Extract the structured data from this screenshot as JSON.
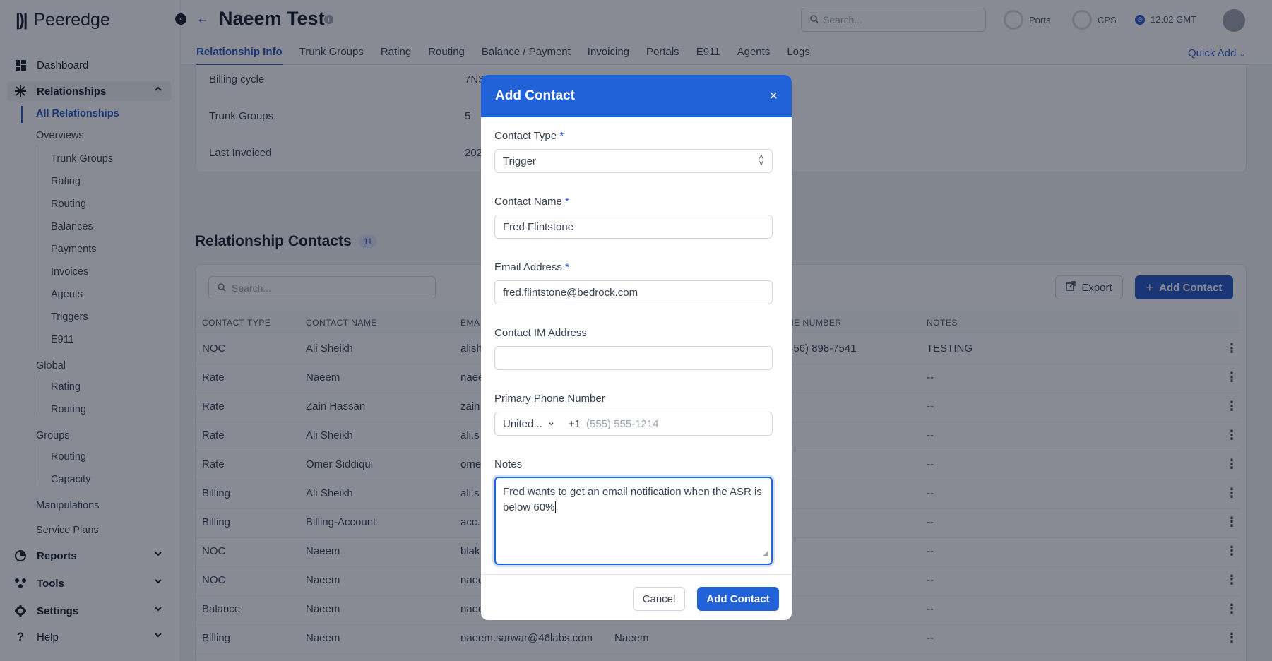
{
  "app": {
    "logo_text": "Peeredge"
  },
  "sidebar": {
    "dashboard": "Dashboard",
    "relationships": "Relationships",
    "all_relationships": "All Relationships",
    "overviews": "Overviews",
    "overview_items": [
      "Trunk Groups",
      "Rating",
      "Routing",
      "Balances",
      "Payments",
      "Invoices",
      "Agents",
      "Triggers",
      "E911"
    ],
    "global": "Global",
    "global_items": [
      "Rating",
      "Routing"
    ],
    "groups": "Groups",
    "groups_items": [
      "Routing",
      "Capacity"
    ],
    "manipulations": "Manipulations",
    "service_plans": "Service Plans",
    "reports": "Reports",
    "tools": "Tools",
    "settings": "Settings",
    "help": "Help"
  },
  "header": {
    "title": "Naeem Test",
    "search_placeholder": "Search...",
    "ports_label": "Ports",
    "cps_label": "CPS",
    "time": "12:02 GMT",
    "quick_add": "Quick Add",
    "tabs": [
      "Relationship Info",
      "Trunk Groups",
      "Rating",
      "Routing",
      "Balance / Payment",
      "Invoicing",
      "Portals",
      "E911",
      "Agents",
      "Logs"
    ]
  },
  "info": {
    "billing_cycle_label": "Billing cycle",
    "billing_cycle_value": "7N3",
    "trunk_groups_label": "Trunk Groups",
    "trunk_groups_value": "5",
    "last_invoiced_label": "Last Invoiced",
    "last_invoiced_value": "202"
  },
  "contacts": {
    "title": "Relationship Contacts",
    "count": "11",
    "search_placeholder": "Search...",
    "export_label": "Export",
    "add_label": "Add Contact",
    "headers": {
      "type": "CONTACT TYPE",
      "name": "CONTACT NAME",
      "email": "EMA",
      "phone": "NE NUMBER",
      "notes": "NOTES"
    },
    "rows": [
      {
        "type": "NOC",
        "name": "Ali Sheikh",
        "email": "alish",
        "extra": "",
        "phone": "456) 898-7541",
        "notes": "TESTING"
      },
      {
        "type": "Rate",
        "name": "Naeem",
        "email": "naee",
        "extra": "",
        "phone": "",
        "notes": "--"
      },
      {
        "type": "Rate",
        "name": "Zain Hassan",
        "email": "zain",
        "extra": "",
        "phone": "",
        "notes": "--"
      },
      {
        "type": "Rate",
        "name": "Ali Sheikh",
        "email": "ali.s",
        "extra": "",
        "phone": "",
        "notes": "--"
      },
      {
        "type": "Rate",
        "name": "Omer Siddiqui",
        "email": "ome",
        "extra": "",
        "phone": "",
        "notes": "--"
      },
      {
        "type": "Billing",
        "name": "Ali Sheikh",
        "email": "ali.s",
        "extra": "",
        "phone": "",
        "notes": "--"
      },
      {
        "type": "Billing",
        "name": "Billing-Account",
        "email": "acc.",
        "extra": "",
        "phone": "",
        "notes": "--"
      },
      {
        "type": "NOC",
        "name": "Naeem",
        "email": "blak",
        "extra": "",
        "phone": "",
        "notes": "--"
      },
      {
        "type": "NOC",
        "name": "Naeem",
        "email": "naee",
        "extra": "",
        "phone": "",
        "notes": "--"
      },
      {
        "type": "Balance",
        "name": "Naeem",
        "email": "naee",
        "extra": "",
        "phone": "",
        "notes": "--"
      },
      {
        "type": "Billing",
        "name": "Naeem",
        "email": "naeem.sarwar@46labs.com",
        "extra": "Naeem",
        "phone": "",
        "notes": "--"
      }
    ]
  },
  "modal": {
    "title": "Add Contact",
    "contact_type_label": "Contact Type",
    "contact_type_value": "Trigger",
    "contact_name_label": "Contact Name",
    "contact_name_value": "Fred Flintstone",
    "email_label": "Email Address",
    "email_value": "fred.flintstone@bedrock.com",
    "im_label": "Contact IM Address",
    "im_value": "",
    "phone_label": "Primary Phone Number",
    "phone_country": "United...",
    "phone_code": "+1",
    "phone_placeholder": "(555) 555-1214",
    "notes_label": "Notes",
    "notes_value": "Fred wants to get an email notification when the ASR is below 60%",
    "required_mark": "*",
    "cancel_label": "Cancel",
    "submit_label": "Add Contact"
  },
  "colors": {
    "accent": "#2262d8",
    "brand_blue": "#2355c6",
    "overlay": "#111827"
  }
}
